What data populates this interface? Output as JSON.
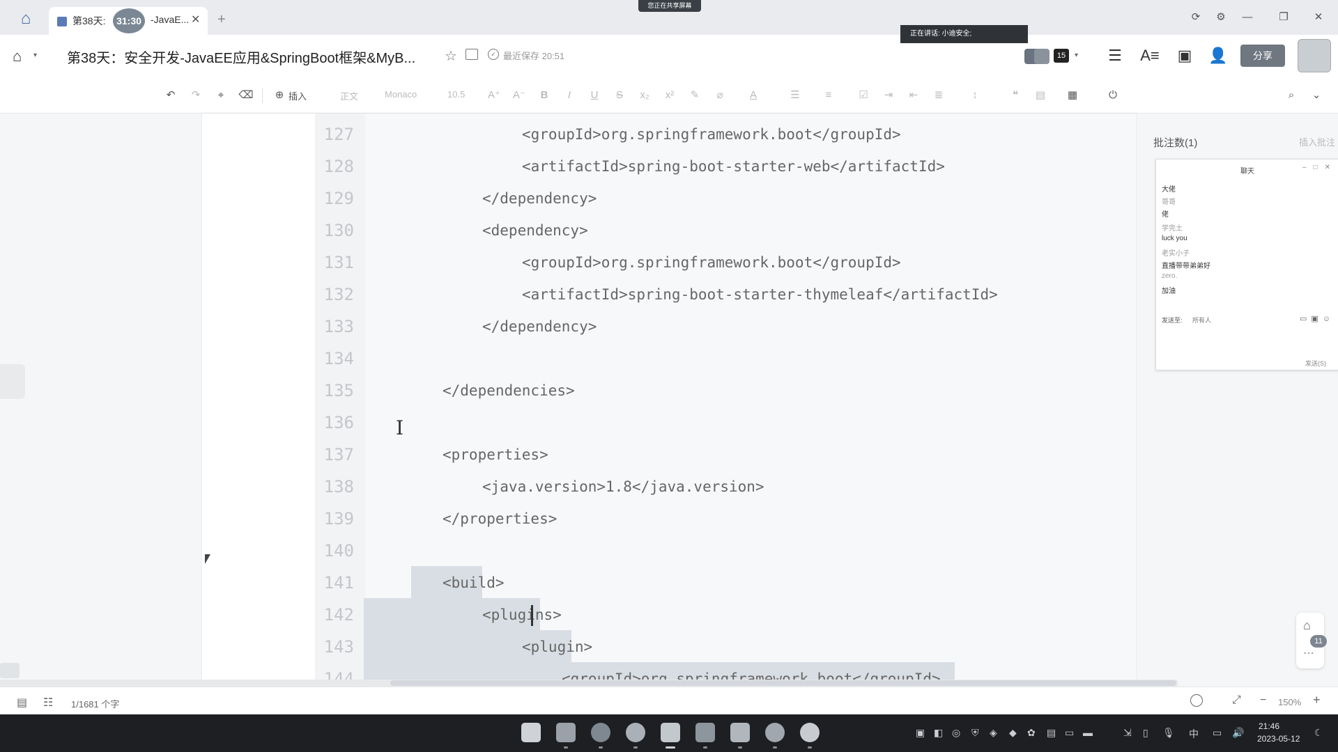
{
  "tab": {
    "title_prefix": "第38天:",
    "timer": "31:30",
    "title_suffix": "-JavaE..."
  },
  "screen_share_banner": "您正在共享屏幕",
  "voice_bar": "正在讲话: 小迪安全;",
  "header": {
    "doc_title": "第38天：安全开发-JavaEE应用&SpringBoot框架&MyB...",
    "saved_status": "最近保存 20:51",
    "collaborator_count": "15",
    "share_label": "分享"
  },
  "toolbar": {
    "insert_label": "插入",
    "style_label": "正文",
    "font_label": "Monaco",
    "size_label": "10.5"
  },
  "code": {
    "lines": [
      {
        "n": "127",
        "text": "<groupId>org.springframework.boot</groupId>"
      },
      {
        "n": "128",
        "text": "<artifactId>spring-boot-starter-web</artifactId>"
      },
      {
        "n": "129",
        "text": "</dependency>"
      },
      {
        "n": "130",
        "text": "<dependency>"
      },
      {
        "n": "131",
        "text": "<groupId>org.springframework.boot</groupId>"
      },
      {
        "n": "132",
        "text": "<artifactId>spring-boot-starter-thymeleaf</artifactId>"
      },
      {
        "n": "133",
        "text": "</dependency>"
      },
      {
        "n": "134",
        "text": ""
      },
      {
        "n": "135",
        "text": "</dependencies>"
      },
      {
        "n": "136",
        "text": ""
      },
      {
        "n": "137",
        "text": "<properties>"
      },
      {
        "n": "138",
        "text": "<java.version>1.8</java.version>"
      },
      {
        "n": "139",
        "text": "</properties>"
      },
      {
        "n": "140",
        "text": ""
      },
      {
        "n": "141",
        "text": "<build>"
      },
      {
        "n": "142",
        "text": "<plugins>"
      },
      {
        "n": "143",
        "text": "<plugin>"
      },
      {
        "n": "144",
        "text": "<groupId>org.springframework.boot</groupId>"
      }
    ]
  },
  "comments": {
    "count_label": "批注数(1)",
    "action_label": "插入批注"
  },
  "chat": {
    "title": "聊天",
    "messages": [
      "大佬",
      "哥哥",
      "佬",
      "学完土",
      "luck you",
      "老实小子",
      "直播带带弟弟好",
      "zero.",
      "加油"
    ],
    "send_to_label": "发送至:",
    "send_to_target": "所有人",
    "send_label": "发送(S)"
  },
  "float_badge": "11",
  "statusbar": {
    "word_count": "1/1681 个字",
    "zoom": "150%"
  },
  "taskbar": {
    "time": "21:46",
    "date": "2023-05-12",
    "ime": "中"
  }
}
